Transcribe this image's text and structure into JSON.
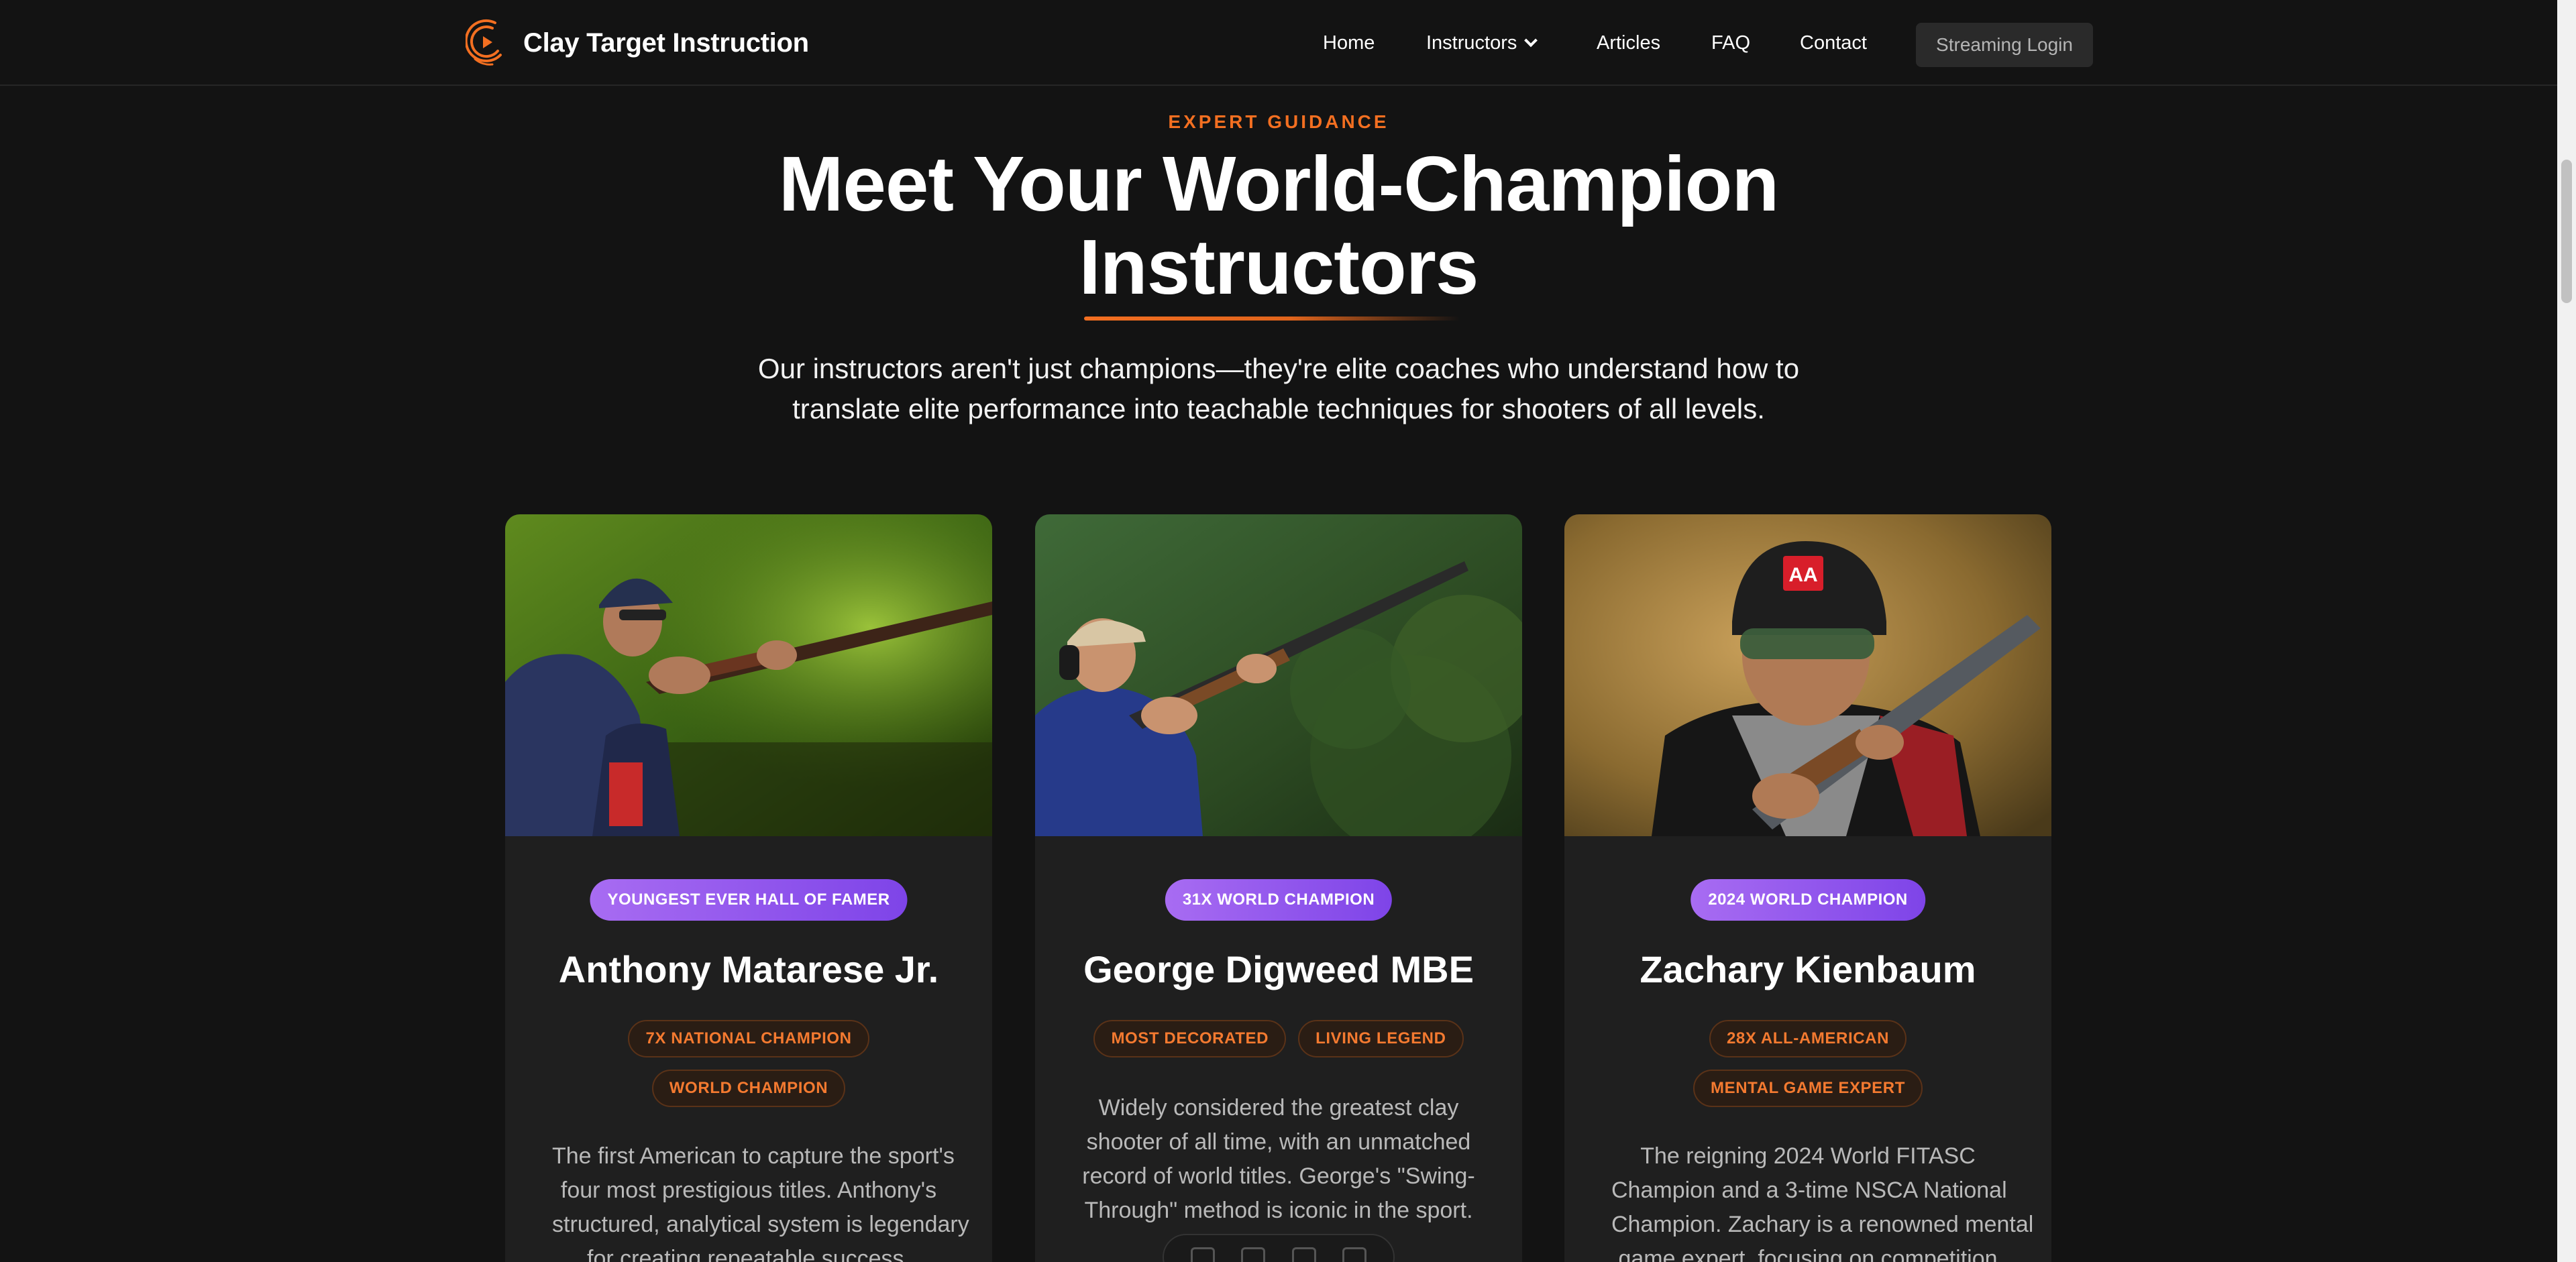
{
  "nav": {
    "brand": "Clay Target Instruction",
    "links": [
      {
        "label": "Home"
      },
      {
        "label": "Instructors"
      },
      {
        "label": "Articles"
      },
      {
        "label": "FAQ"
      },
      {
        "label": "Contact"
      }
    ],
    "login_label": "Streaming Login"
  },
  "hero": {
    "eyebrow": "EXPERT GUIDANCE",
    "title_line1": "Meet Your World-Champion",
    "title_line2": "Instructors",
    "lead_line1": "Our instructors aren't just champions—they're elite coaches who understand how to",
    "lead_line2": "translate elite performance into teachable techniques for shooters of all levels."
  },
  "instructors": [
    {
      "award": "YOUNGEST EVER HALL OF FAMER",
      "name": "Anthony Matarese Jr.",
      "tags": [
        "7X NATIONAL CHAMPION",
        "WORLD CHAMPION"
      ],
      "bio": [
        "The first American to capture the sport's",
        "four most prestigious titles. Anthony's",
        "structured, analytical system is legendary",
        "for creating repeatable success."
      ]
    },
    {
      "award": "31X WORLD CHAMPION",
      "name": "George Digweed MBE",
      "tags": [
        "MOST DECORATED",
        "LIVING LEGEND"
      ],
      "bio": [
        "Widely considered the greatest clay",
        "shooter of all time, with an unmatched",
        "record of world titles. George's \"Swing-",
        "Through\" method is iconic in the sport."
      ]
    },
    {
      "award": "2024 WORLD CHAMPION",
      "name": "Zachary Kienbaum",
      "tags": [
        "28X ALL-AMERICAN",
        "MENTAL GAME EXPERT"
      ],
      "bio": [
        "The reigning 2024 World FITASC",
        "Champion and a 3-time NSCA National",
        "Champion. Zachary is a renowned mental",
        "game expert, focusing on competition"
      ]
    }
  ],
  "colors": {
    "accent": "#f36f21",
    "award_gradient_start": "#a86cf2",
    "award_gradient_end": "#7e44e8",
    "background": "#131313",
    "card": "#1f1f1f"
  },
  "icons": [
    "logo-play-icon",
    "chevron-down-icon"
  ]
}
